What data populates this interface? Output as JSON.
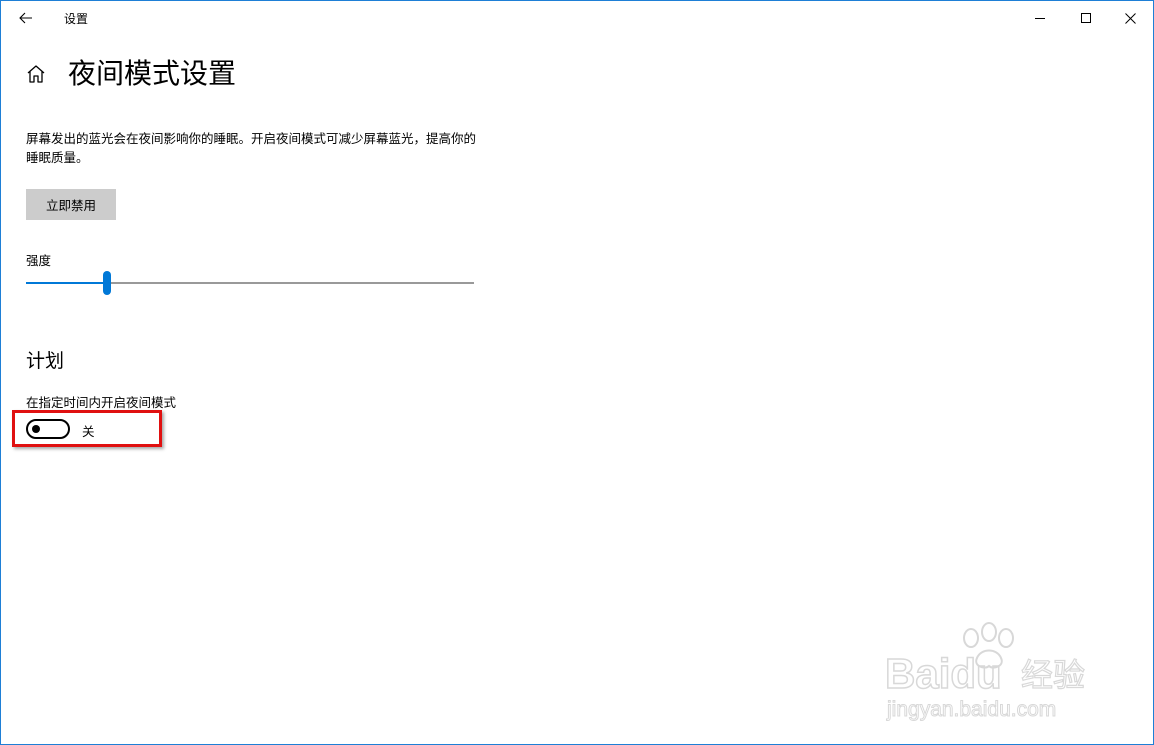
{
  "window": {
    "title": "设置"
  },
  "header": {
    "page_title": "夜间模式设置"
  },
  "description": {
    "text": "屏幕发出的蓝光会在夜间影响你的睡眠。开启夜间模式可减少屏幕蓝光，提高你的睡眠质量。"
  },
  "actions": {
    "disable_now_label": "立即禁用"
  },
  "strength": {
    "label": "强度",
    "value_percent": 18
  },
  "schedule": {
    "section_title": "计划",
    "toggle_label": "在指定时间内开启夜间模式",
    "toggle_state_text": "关",
    "toggle_on": false
  },
  "watermark": {
    "brand": "Baidu",
    "brand_cn": "经验",
    "url": "jingyan.baidu.com"
  },
  "colors": {
    "accent": "#0078d7",
    "highlight": "#e01010",
    "button_bg": "#cccccc",
    "window_border": "#1e7fd6"
  },
  "icons": {
    "back": "back-arrow-icon",
    "home": "home-icon",
    "minimize": "minimize-icon",
    "maximize": "maximize-icon",
    "close": "close-icon"
  }
}
